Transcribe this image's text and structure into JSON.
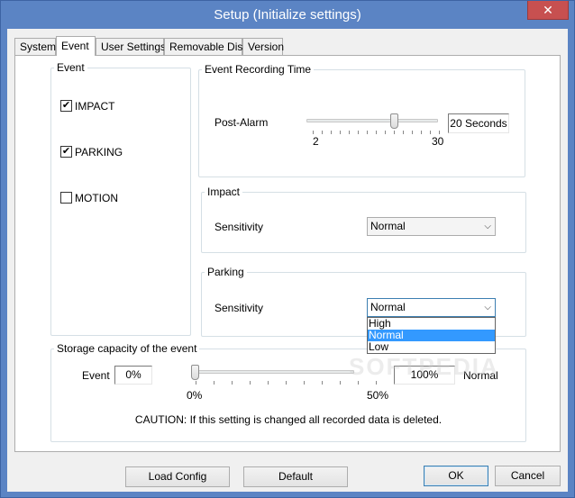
{
  "window": {
    "title": "Setup (Initialize settings)",
    "close_glyph": "✕"
  },
  "tabs": [
    {
      "label": "System",
      "active": false
    },
    {
      "label": "Event",
      "active": true
    },
    {
      "label": "User Settings",
      "active": false
    },
    {
      "label": "Removable Disk",
      "active": false
    },
    {
      "label": "Version",
      "active": false
    }
  ],
  "event_group": {
    "title": "Event",
    "items": [
      {
        "label": "IMPACT",
        "checked": true
      },
      {
        "label": "PARKING",
        "checked": true
      },
      {
        "label": "MOTION",
        "checked": false
      }
    ],
    "check_glyph": "✔"
  },
  "recording": {
    "title": "Event Recording Time",
    "post_alarm_label": "Post-Alarm",
    "slider_min": "2",
    "slider_max": "30",
    "slider_value": 20,
    "value_text": "20 Seconds"
  },
  "impact": {
    "title": "Impact",
    "sensitivity_label": "Sensitivity",
    "selected": "Normal"
  },
  "parking": {
    "title": "Parking",
    "sensitivity_label": "Sensitivity",
    "selected": "Normal",
    "options": [
      "High",
      "Normal",
      "Low"
    ]
  },
  "storage": {
    "title": "Storage capacity of the event",
    "event_label": "Event",
    "event_value": "0%",
    "slider_min": "0%",
    "slider_max": "50%",
    "normal_value": "100%",
    "normal_label": "Normal",
    "caution": "CAUTION: If this setting is changed all recorded data is deleted."
  },
  "buttons": {
    "load_config": "Load Config",
    "default": "Default",
    "ok": "OK",
    "cancel": "Cancel"
  },
  "icons": {
    "combo_arrow": "chevron-down-icon",
    "arrow_glyph": "⌵"
  },
  "watermark": "SOFTPEDIA",
  "colors": {
    "title_bar": "#5b84c4",
    "close_button": "#c75050",
    "selection": "#3399ff"
  }
}
